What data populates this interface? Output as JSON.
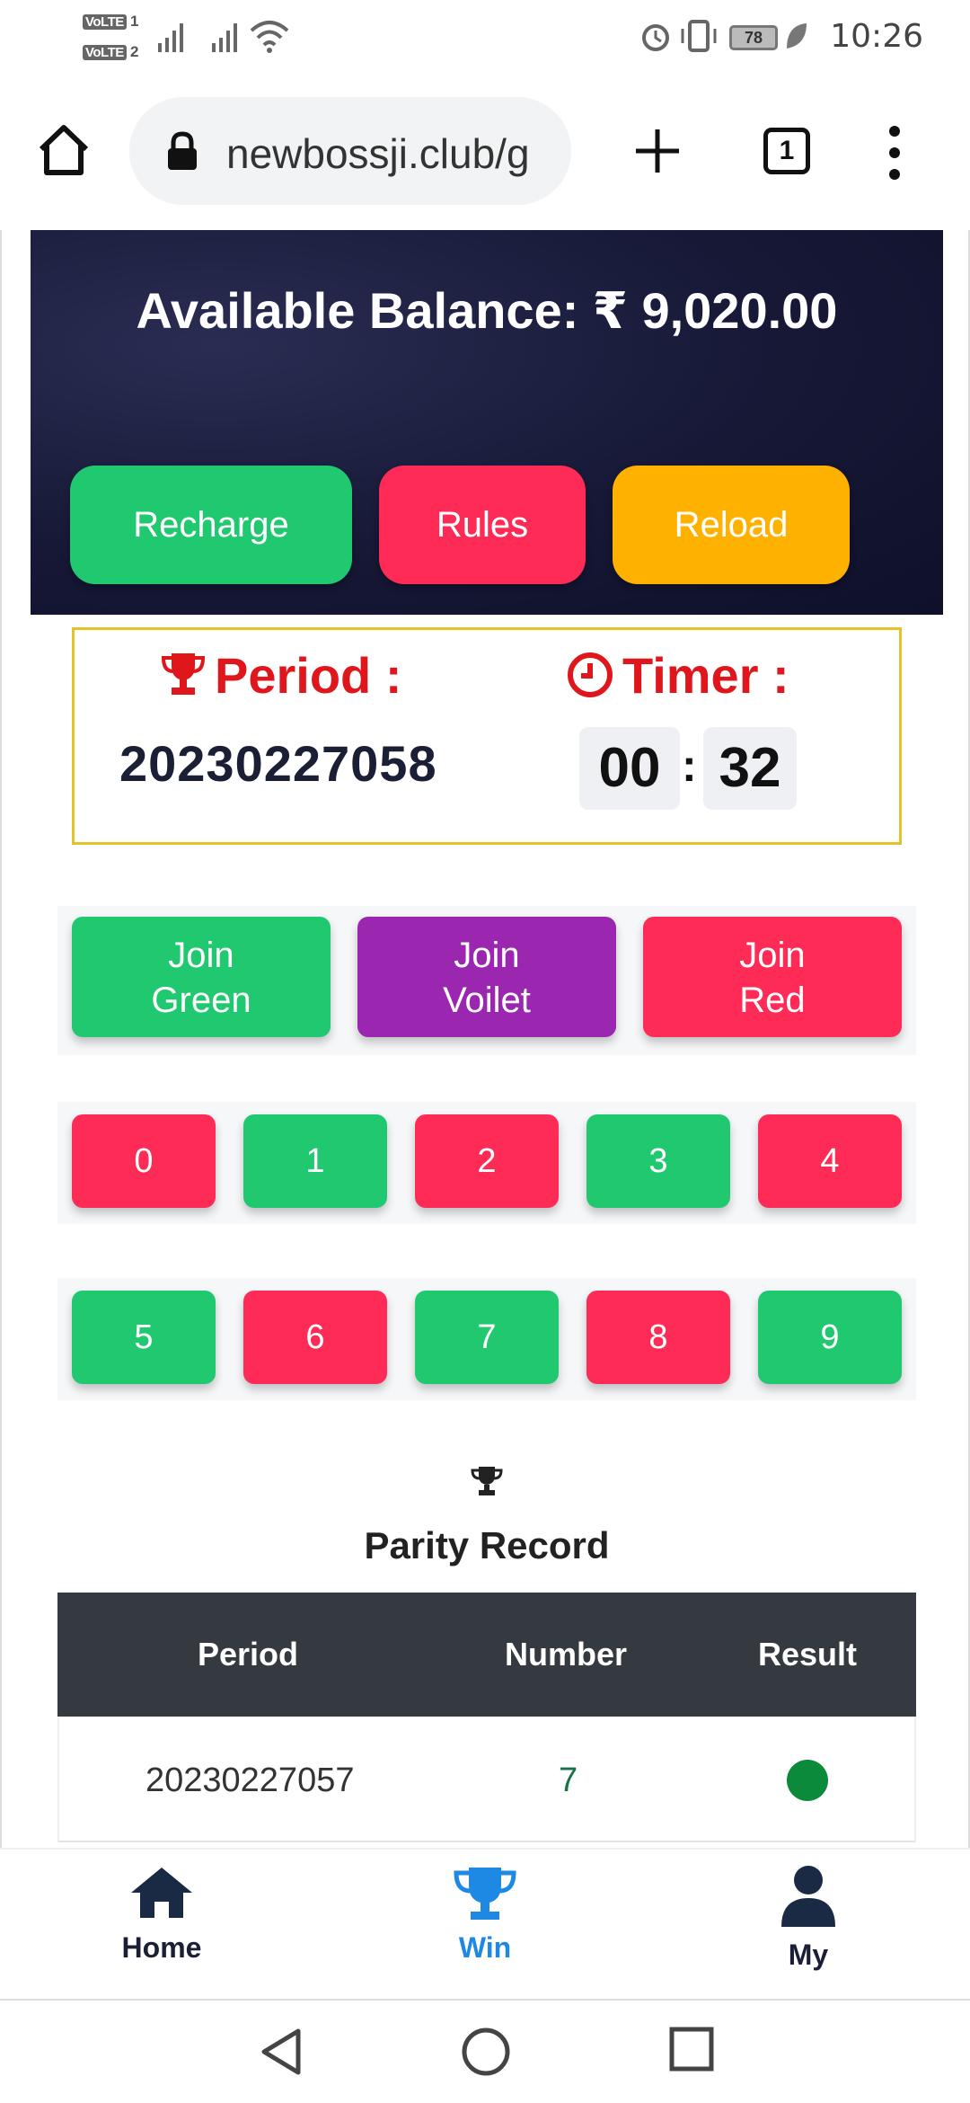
{
  "status_bar": {
    "volte_1": "VoLTE",
    "volte_1_sim": "1",
    "volte_2": "VoLTE",
    "volte_2_sim": "2",
    "battery": "78",
    "time": "10:26"
  },
  "browser": {
    "url": "newbossji.club/g",
    "tab_count": "1"
  },
  "balance": {
    "label": "Available Balance: ₹ 9,020.00"
  },
  "actions": {
    "recharge": "Recharge",
    "rules": "Rules",
    "reload": "Reload"
  },
  "period": {
    "label": "Period :",
    "value": "20230227058"
  },
  "timer": {
    "label": "Timer :",
    "minutes": "00",
    "separator": ":",
    "seconds": "32"
  },
  "join": {
    "green_line1": "Join",
    "green_line2": "Green",
    "violet_line1": "Join",
    "violet_line2": "Voilet",
    "red_line1": "Join",
    "red_line2": "Red"
  },
  "numbers": [
    {
      "label": "0",
      "color": "#fd2b55"
    },
    {
      "label": "1",
      "color": "#20c86f"
    },
    {
      "label": "2",
      "color": "#fd2b55"
    },
    {
      "label": "3",
      "color": "#20c86f"
    },
    {
      "label": "4",
      "color": "#fd2b55"
    },
    {
      "label": "5",
      "color": "#20c86f"
    },
    {
      "label": "6",
      "color": "#fd2b55"
    },
    {
      "label": "7",
      "color": "#20c86f"
    },
    {
      "label": "8",
      "color": "#fd2b55"
    },
    {
      "label": "9",
      "color": "#20c86f"
    }
  ],
  "record": {
    "title": "Parity Record",
    "columns": [
      "Period",
      "Number",
      "Result"
    ],
    "rows": [
      {
        "period": "20230227057",
        "number": "7",
        "result_color": "#0a8a3a"
      }
    ]
  },
  "bottom_nav": {
    "home": "Home",
    "win": "Win",
    "my": "My",
    "active": "Win",
    "active_color": "#1e88e5"
  }
}
